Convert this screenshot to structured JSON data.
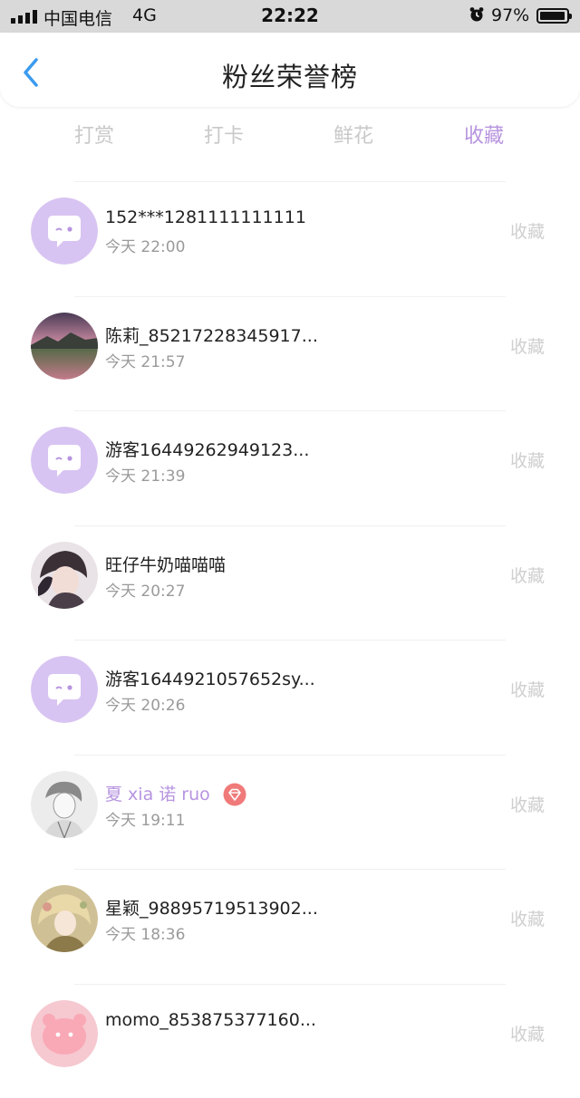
{
  "status_bar": {
    "carrier": "中国电信",
    "network": "4G",
    "time": "22:22",
    "battery": "97%"
  },
  "header": {
    "title": "粉丝荣誉榜"
  },
  "tabs": [
    {
      "label": "打赏"
    },
    {
      "label": "打卡"
    },
    {
      "label": "鲜花"
    },
    {
      "label": "收藏",
      "active": true
    }
  ],
  "fans": [
    {
      "name": "152***1281111111111",
      "time": "今天 22:00",
      "action": "收藏",
      "avatar": "default-chat-avatar"
    },
    {
      "name": "陈莉_85217228345917...",
      "time": "今天 21:57",
      "action": "收藏",
      "avatar": "landscape-photo-avatar"
    },
    {
      "name": "游客16449262949123...",
      "time": "今天 21:39",
      "action": "收藏",
      "avatar": "default-chat-avatar"
    },
    {
      "name": "旺仔牛奶喵喵喵",
      "time": "今天 20:27",
      "action": "收藏",
      "avatar": "anime-photo-avatar"
    },
    {
      "name": "游客1644921057652sy...",
      "time": "今天 20:26",
      "action": "收藏",
      "avatar": "default-chat-avatar"
    },
    {
      "name": "夏 xia 诺 ruo",
      "time": "今天 19:11",
      "action": "收藏",
      "avatar": "sketch-photo-avatar",
      "vip": true
    },
    {
      "name": "星颖_98895719513902...",
      "time": "今天 18:36",
      "action": "收藏",
      "avatar": "illustration-photo-avatar"
    },
    {
      "name": "momo_853875377160...",
      "time": "",
      "action": "收藏",
      "avatar": "pink-cartoon-avatar"
    }
  ],
  "colors": {
    "accent": "#b794e0",
    "vip_badge": "#f07a7a",
    "back_arrow": "#3a9bef"
  }
}
